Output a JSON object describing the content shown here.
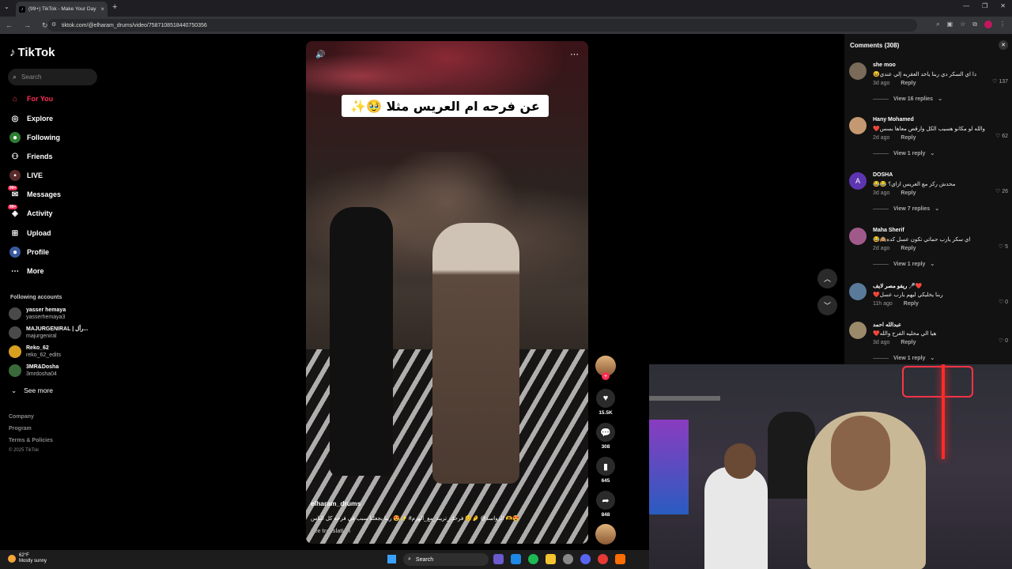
{
  "browser": {
    "tab_title": "(99+) TikTok - Make Your Day",
    "url": "tiktok.com/@elharam_drums/video/7587108518440750356"
  },
  "nav": {
    "logo": "TikTok",
    "search_placeholder": "Search",
    "items": [
      {
        "label": "For You",
        "icon": "home-icon"
      },
      {
        "label": "Explore",
        "icon": "compass-icon"
      },
      {
        "label": "Following",
        "icon": "following-icon"
      },
      {
        "label": "Friends",
        "icon": "friends-icon"
      },
      {
        "label": "LIVE",
        "icon": "live-icon"
      },
      {
        "label": "Messages",
        "icon": "messages-icon",
        "badge": "99+"
      },
      {
        "label": "Activity",
        "icon": "activity-icon",
        "badge": "99+"
      },
      {
        "label": "Upload",
        "icon": "upload-icon"
      },
      {
        "label": "Profile",
        "icon": "profile-icon"
      },
      {
        "label": "More",
        "icon": "more-icon"
      }
    ],
    "following_header": "Following accounts",
    "accounts": [
      {
        "name": "yasser hemaya",
        "handle": "yasserhemaya3"
      },
      {
        "name": "MAJURGENIRAL | رأل...",
        "handle": "majurgeniral"
      },
      {
        "name": "Reko_62",
        "handle": "reko_62_edits"
      },
      {
        "name": "3MR&Dosha",
        "handle": "3mrdosha04"
      }
    ],
    "see_more": "See more",
    "footer": [
      "Company",
      "Program",
      "Terms & Policies"
    ],
    "copyright": "© 2025 TikTok"
  },
  "video": {
    "overlay_text": "عن فرحه ام العريس مثلا 🥹✨",
    "author": "elharam_drums",
    "description": "😍🫶 الرواسد@ 🤌😊 فرحك_تريند_مع_الهرم# ✨😍 ربنا يجعلنا سبب في فرحه كل الناس",
    "see_translation": "See translation",
    "likes": "15.5K",
    "comments": "308",
    "saves": "645",
    "shares": "848"
  },
  "comments": {
    "header": "Comments (308)",
    "reply_label": "Reply",
    "items": [
      {
        "name": "she moo",
        "text": "دا اي السكر دي ربنا ياخد العقربه إلي عندي😆",
        "time": "3d ago",
        "likes": "137",
        "replies": "View 16 replies"
      },
      {
        "name": "Hany Mohamed",
        "text": "والله لو مكانو هسيب الكل وارقص معاها بسس❤️",
        "time": "2d ago",
        "likes": "62",
        "replies": "View 1 reply"
      },
      {
        "name": "DOSHA",
        "text": "محدش ركز مع العريس ازاي؟ 😂😂",
        "time": "3d ago",
        "likes": "26",
        "replies": "View 7 replies",
        "avatar_letter": "A"
      },
      {
        "name": "Maha Sherif",
        "text": "اي سكر يارب حماتي تكون عسل كده🙈😂",
        "time": "2d ago",
        "likes": "5",
        "replies": "View 1 reply"
      },
      {
        "name": "ريفو مصر لايف 🎤❤️",
        "text": "ربنا يخليكي ليهم يارب عسل❤️",
        "time": "11h ago",
        "likes": "0",
        "replies": ""
      },
      {
        "name": "عبدالله احمد",
        "text": "هيا الي محليه الفرح والله❤️",
        "time": "3d ago",
        "likes": "0",
        "replies": "View 1 reply"
      }
    ]
  },
  "taskbar": {
    "temp": "62°F",
    "weather": "Mostly sunny",
    "search": "Search"
  }
}
